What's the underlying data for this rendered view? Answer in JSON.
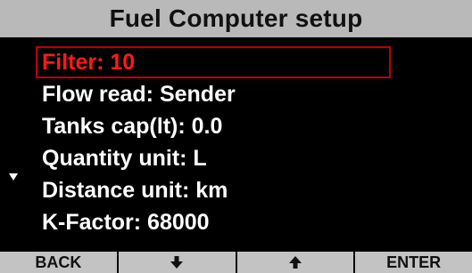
{
  "title": "Fuel Computer setup",
  "menu": {
    "items": [
      {
        "label": "Filter: 10"
      },
      {
        "label": "Flow read: Sender"
      },
      {
        "label": "Tanks cap(lt): 0.0"
      },
      {
        "label": "Quantity unit: L"
      },
      {
        "label": "Distance unit: km"
      },
      {
        "label": "K-Factor: 68000"
      }
    ],
    "selected_index": 0
  },
  "softkeys": {
    "back": "BACK",
    "down_icon": "arrow-down-icon",
    "up_icon": "arrow-up-icon",
    "enter": "ENTER"
  },
  "colors": {
    "title_bg": "#b9b9b9",
    "selected_text": "#ff1a1a",
    "selection_border": "#c00000",
    "softkey_bg": "#c3c3c3"
  }
}
